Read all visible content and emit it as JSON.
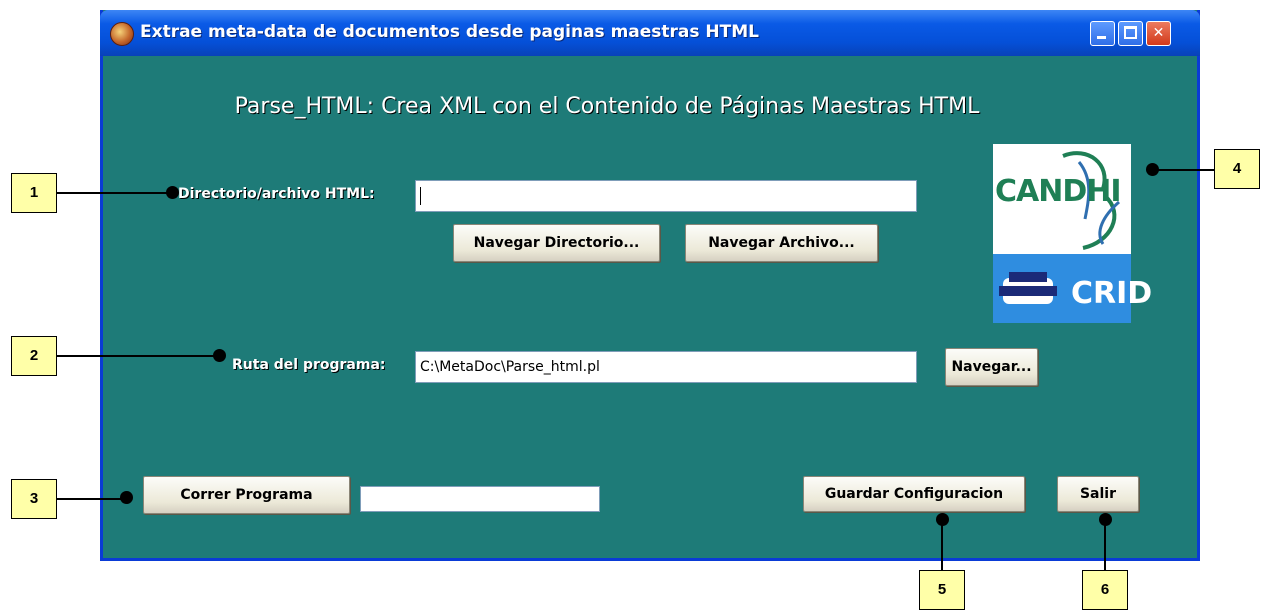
{
  "window": {
    "title": "Extrae meta-data de documentos desde paginas maestras HTML",
    "minimize_symbol": "_",
    "maximize_symbol": "□",
    "close_symbol": "✕"
  },
  "main": {
    "heading": "Parse_HTML: Crea XML con el Contenido de Páginas Maestras HTML",
    "directory_label": "Directorio/archivo HTML:",
    "directory_value": "",
    "browse_directory_button": "Navegar Directorio...",
    "browse_file_button": "Navegar Archivo...",
    "program_path_label": "Ruta del programa:",
    "program_path_value": "C:\\MetaDoc\\Parse_html.pl",
    "browse_button": "Navegar...",
    "run_button": "Correr Programa",
    "status_value": "",
    "save_config_button": "Guardar Configuracion",
    "exit_button": "Salir"
  },
  "logo": {
    "top_text": "CANDHI",
    "bottom_text": "CRID"
  },
  "callouts": [
    "1",
    "2",
    "3",
    "4",
    "5",
    "6"
  ],
  "colors": {
    "window_background": "#1e7b78",
    "titlebar": "#0550d8",
    "callout_background": "#ffffa8"
  }
}
